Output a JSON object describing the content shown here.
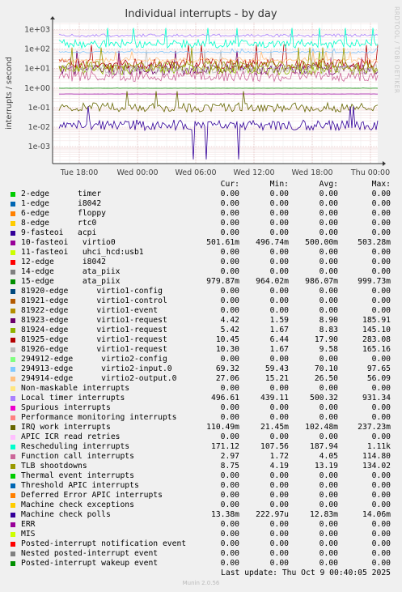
{
  "title": "Individual interrupts - by day",
  "side_credit": "RRDTOOL / TOBI OETIKER",
  "footer": {
    "last_update": "Last update: Thu Oct  9 00:40:05 2025",
    "munin": "Munin 2.0.56"
  },
  "legend_headers": {
    "cur": "Cur:",
    "min": "Min:",
    "avg": "Avg:",
    "max": "Max:"
  },
  "chart_data": {
    "type": "line",
    "title": "Individual interrupts - by day",
    "ylabel": "interrupts / second",
    "y_scale": "log",
    "ylim": [
      0.0005,
      3000
    ],
    "y_ticks": [
      "1e-03",
      "1e-02",
      "1e-01",
      "1e+00",
      "1e+01",
      "1e+02",
      "1e+03"
    ],
    "x_ticks": [
      "Tue 18:00",
      "Wed 00:00",
      "Wed 06:00",
      "Wed 12:00",
      "Wed 18:00",
      "Thu 00:00"
    ],
    "grid": true,
    "series": [
      {
        "name": "2-edge      timer",
        "color": "#00cc00",
        "cur": "0.00",
        "min": "0.00",
        "avg": "0.00",
        "max": "0.00"
      },
      {
        "name": "1-edge      i8042",
        "color": "#0066b3",
        "cur": "0.00",
        "min": "0.00",
        "avg": "0.00",
        "max": "0.00"
      },
      {
        "name": "6-edge      floppy",
        "color": "#ff8000",
        "cur": "0.00",
        "min": "0.00",
        "avg": "0.00",
        "max": "0.00"
      },
      {
        "name": "8-edge      rtc0",
        "color": "#ffcc00",
        "cur": "0.00",
        "min": "0.00",
        "avg": "0.00",
        "max": "0.00"
      },
      {
        "name": "9-fasteoi   acpi",
        "color": "#330099",
        "cur": "0.00",
        "min": "0.00",
        "avg": "0.00",
        "max": "0.00"
      },
      {
        "name": "10-fasteoi   virtio0",
        "color": "#990099",
        "cur": "501.61m",
        "min": "496.74m",
        "avg": "500.00m",
        "max": "503.28m"
      },
      {
        "name": "11-fasteoi   uhci_hcd:usb1",
        "color": "#ccff00",
        "cur": "0.00",
        "min": "0.00",
        "avg": "0.00",
        "max": "0.00"
      },
      {
        "name": "12-edge      i8042",
        "color": "#ff0000",
        "cur": "0.00",
        "min": "0.00",
        "avg": "0.00",
        "max": "0.00"
      },
      {
        "name": "14-edge      ata_piix",
        "color": "#808080",
        "cur": "0.00",
        "min": "0.00",
        "avg": "0.00",
        "max": "0.00"
      },
      {
        "name": "15-edge      ata_piix",
        "color": "#008f00",
        "cur": "979.87m",
        "min": "964.02m",
        "avg": "986.07m",
        "max": "999.73m"
      },
      {
        "name": "81920-edge      virtio1-config",
        "color": "#00487d",
        "cur": "0.00",
        "min": "0.00",
        "avg": "0.00",
        "max": "0.00"
      },
      {
        "name": "81921-edge      virtio1-control",
        "color": "#b35a00",
        "cur": "0.00",
        "min": "0.00",
        "avg": "0.00",
        "max": "0.00"
      },
      {
        "name": "81922-edge      virtio1-event",
        "color": "#b38f00",
        "cur": "0.00",
        "min": "0.00",
        "avg": "0.00",
        "max": "0.00"
      },
      {
        "name": "81923-edge      virtio1-request",
        "color": "#6b006b",
        "cur": "4.42",
        "min": "1.59",
        "avg": "8.90",
        "max": "185.91"
      },
      {
        "name": "81924-edge      virtio1-request",
        "color": "#8fb300",
        "cur": "5.42",
        "min": "1.67",
        "avg": "8.83",
        "max": "145.10"
      },
      {
        "name": "81925-edge      virtio1-request",
        "color": "#b30000",
        "cur": "10.45",
        "min": "6.44",
        "avg": "17.90",
        "max": "283.08"
      },
      {
        "name": "81926-edge      virtio1-request",
        "color": "#bebebe",
        "cur": "10.30",
        "min": "1.67",
        "avg": "9.58",
        "max": "165.16"
      },
      {
        "name": "294912-edge      virtio2-config",
        "color": "#80ff80",
        "cur": "0.00",
        "min": "0.00",
        "avg": "0.00",
        "max": "0.00"
      },
      {
        "name": "294913-edge      virtio2-input.0",
        "color": "#80c9ff",
        "cur": "69.32",
        "min": "59.43",
        "avg": "70.10",
        "max": "97.65"
      },
      {
        "name": "294914-edge      virtio2-output.0",
        "color": "#ffc080",
        "cur": "27.06",
        "min": "15.21",
        "avg": "26.50",
        "max": "56.09"
      },
      {
        "name": "Non-maskable interrupts",
        "color": "#ffe680",
        "cur": "0.00",
        "min": "0.00",
        "avg": "0.00",
        "max": "0.00"
      },
      {
        "name": "Local timer interrupts",
        "color": "#aa80ff",
        "cur": "496.61",
        "min": "439.11",
        "avg": "500.32",
        "max": "931.34"
      },
      {
        "name": "Spurious interrupts",
        "color": "#ee00cc",
        "cur": "0.00",
        "min": "0.00",
        "avg": "0.00",
        "max": "0.00"
      },
      {
        "name": "Performance monitoring interrupts",
        "color": "#ff8080",
        "cur": "0.00",
        "min": "0.00",
        "avg": "0.00",
        "max": "0.00"
      },
      {
        "name": "IRQ work interrupts",
        "color": "#666600",
        "cur": "110.49m",
        "min": "21.45m",
        "avg": "102.48m",
        "max": "237.23m"
      },
      {
        "name": "APIC ICR read retries",
        "color": "#ffbfff",
        "cur": "0.00",
        "min": "0.00",
        "avg": "0.00",
        "max": "0.00"
      },
      {
        "name": "Rescheduling interrupts",
        "color": "#00ffcc",
        "cur": "171.12",
        "min": "107.56",
        "avg": "187.94",
        "max": "1.11k"
      },
      {
        "name": "Function call interrupts",
        "color": "#cc6699",
        "cur": "2.97",
        "min": "1.72",
        "avg": "4.05",
        "max": "114.80"
      },
      {
        "name": "TLB shootdowns",
        "color": "#999900",
        "cur": "8.75",
        "min": "4.19",
        "avg": "13.19",
        "max": "134.02"
      },
      {
        "name": "Thermal event interrupts",
        "color": "#00cc00",
        "cur": "0.00",
        "min": "0.00",
        "avg": "0.00",
        "max": "0.00"
      },
      {
        "name": "Threshold APIC interrupts",
        "color": "#0066b3",
        "cur": "0.00",
        "min": "0.00",
        "avg": "0.00",
        "max": "0.00"
      },
      {
        "name": "Deferred Error APIC interrupts",
        "color": "#ff8000",
        "cur": "0.00",
        "min": "0.00",
        "avg": "0.00",
        "max": "0.00"
      },
      {
        "name": "Machine check exceptions",
        "color": "#ffcc00",
        "cur": "0.00",
        "min": "0.00",
        "avg": "0.00",
        "max": "0.00"
      },
      {
        "name": "Machine check polls",
        "color": "#330099",
        "cur": "13.38m",
        "min": "222.97u",
        "avg": "12.83m",
        "max": "14.06m"
      },
      {
        "name": "ERR",
        "color": "#990099",
        "cur": "0.00",
        "min": "0.00",
        "avg": "0.00",
        "max": "0.00"
      },
      {
        "name": "MIS",
        "color": "#ccff00",
        "cur": "0.00",
        "min": "0.00",
        "avg": "0.00",
        "max": "0.00"
      },
      {
        "name": "Posted-interrupt notification event",
        "color": "#ff0000",
        "cur": "0.00",
        "min": "0.00",
        "avg": "0.00",
        "max": "0.00"
      },
      {
        "name": "Nested posted-interrupt event",
        "color": "#808080",
        "cur": "0.00",
        "min": "0.00",
        "avg": "0.00",
        "max": "0.00"
      },
      {
        "name": "Posted-interrupt wakeup event",
        "color": "#008f00",
        "cur": "0.00",
        "min": "0.00",
        "avg": "0.00",
        "max": "0.00"
      }
    ]
  }
}
